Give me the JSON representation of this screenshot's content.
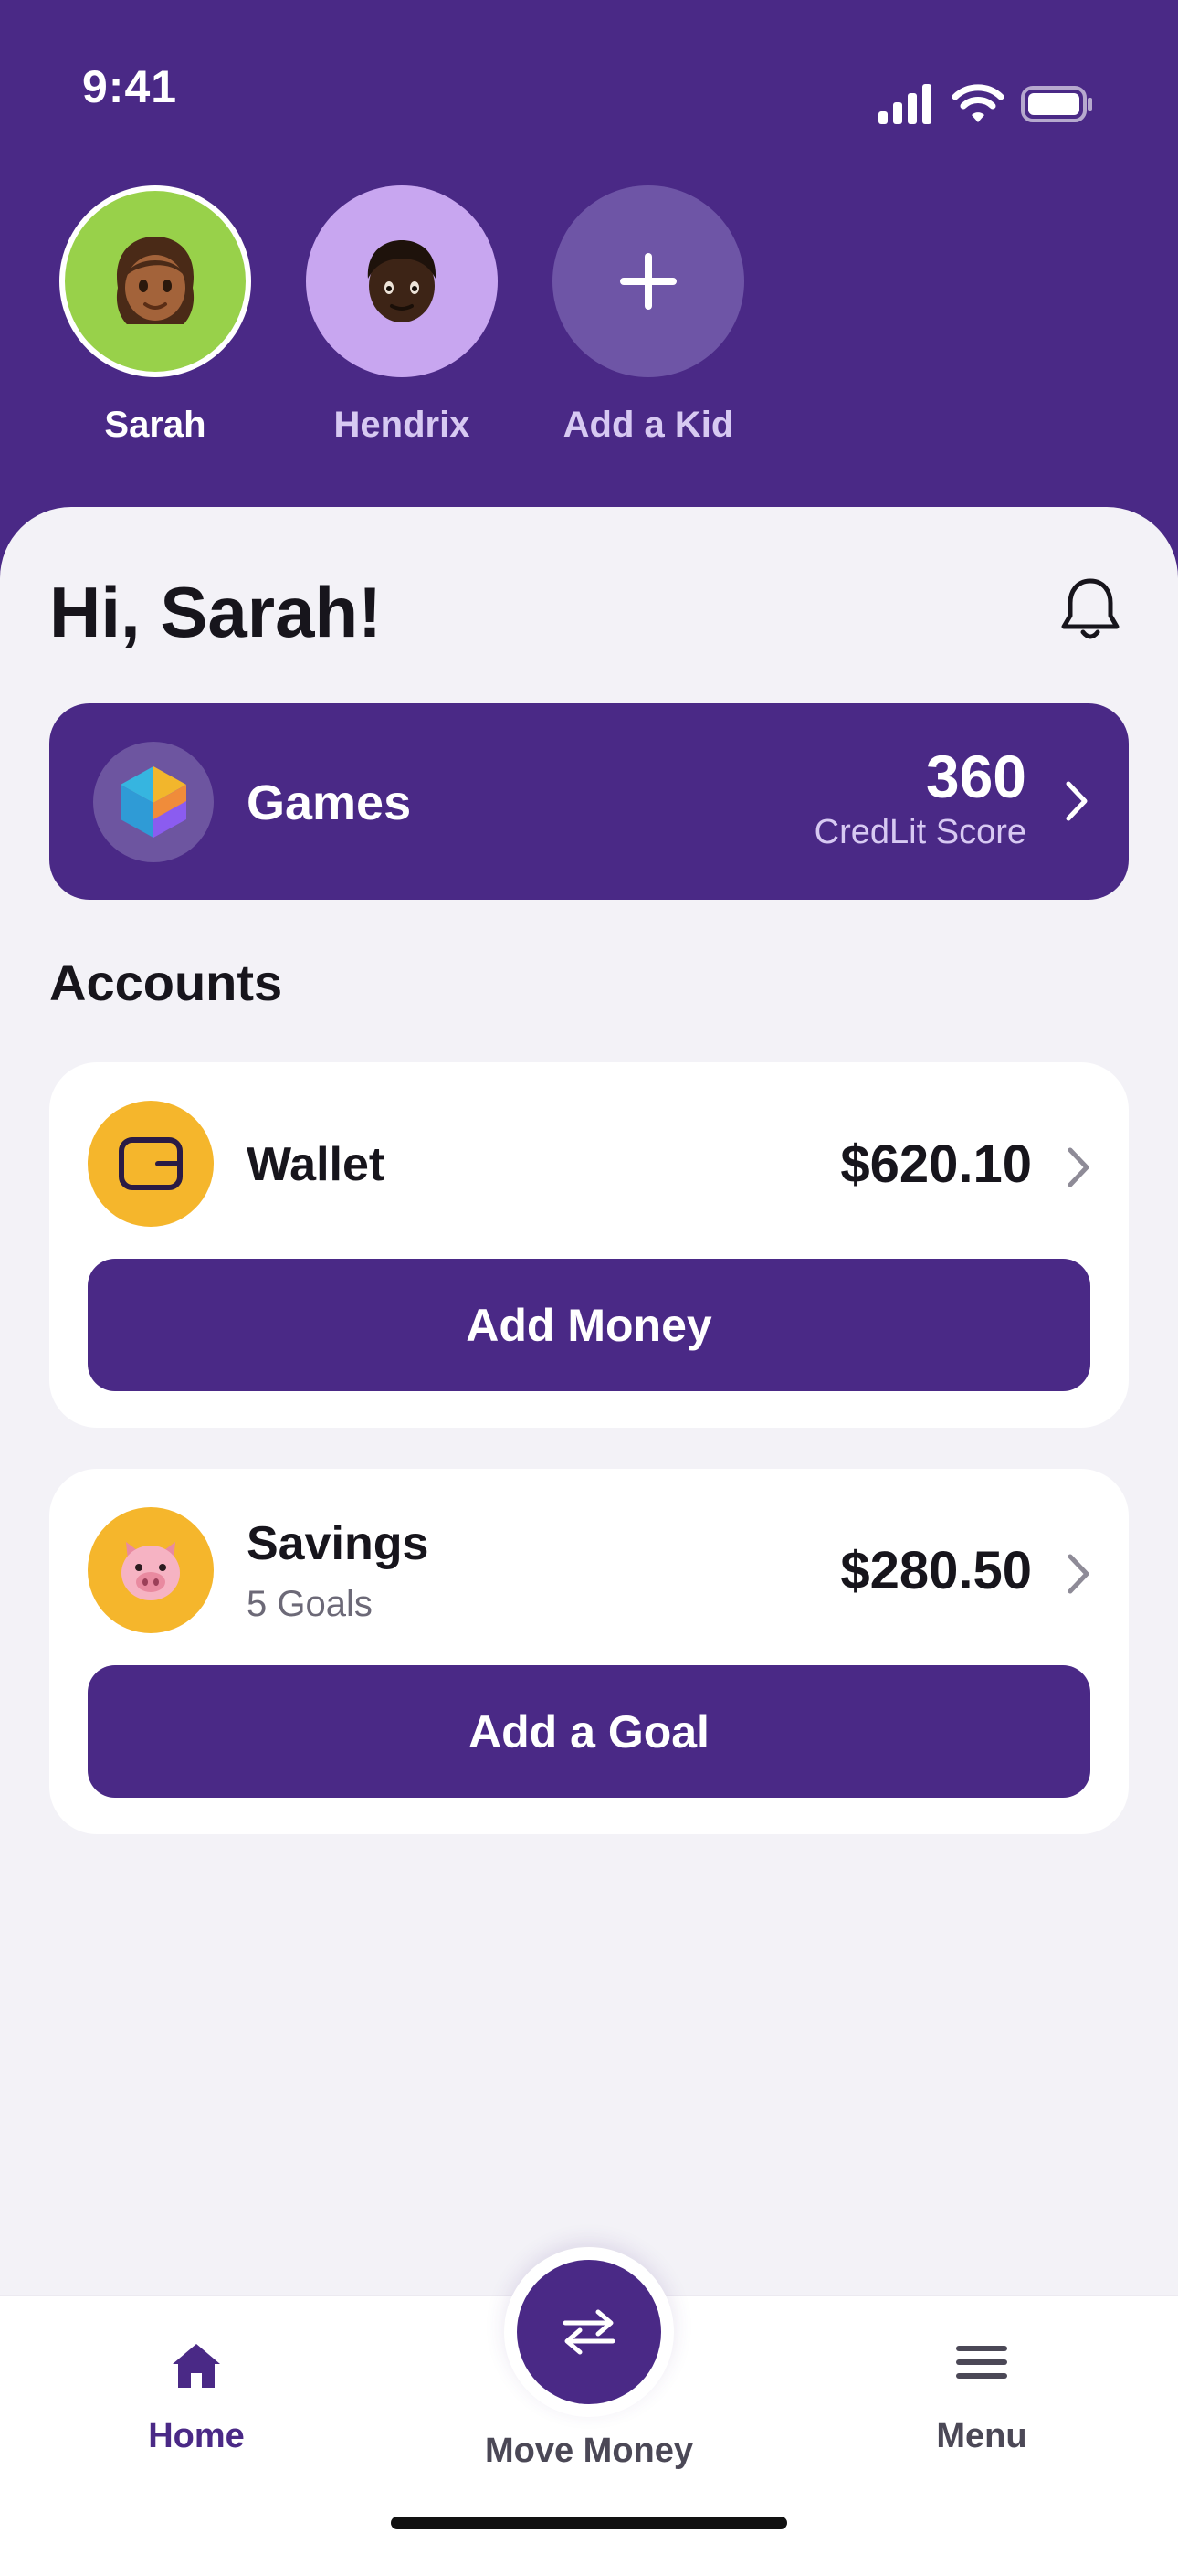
{
  "status_bar": {
    "time": "9:41"
  },
  "kids": [
    {
      "name": "Sarah",
      "avatar_icon": "girl-emoji-icon",
      "bg": "#98D14A",
      "selected": true
    },
    {
      "name": "Hendrix",
      "avatar_icon": "boy-emoji-icon",
      "bg": "#C8A6F0",
      "selected": false
    },
    {
      "name": "Add a Kid",
      "avatar_icon": "plus-icon",
      "bg": "#6E55A6",
      "selected": false
    }
  ],
  "greeting": "Hi, Sarah!",
  "games": {
    "label": "Games",
    "score": "360",
    "score_label": "CredLit Score"
  },
  "accounts_title": "Accounts",
  "accounts": [
    {
      "name": "Wallet",
      "sub": "",
      "amount": "$620.10",
      "button": "Add Money",
      "icon": "wallet-icon"
    },
    {
      "name": "Savings",
      "sub": "5 Goals",
      "amount": "$280.50",
      "button": "Add a Goal",
      "icon": "pig-icon"
    }
  ],
  "tabbar": {
    "home": "Home",
    "move_money": "Move Money",
    "menu": "Menu"
  },
  "colors": {
    "brand": "#4A2986",
    "accent": "#F5B62C",
    "background": "#F3F2F7"
  }
}
